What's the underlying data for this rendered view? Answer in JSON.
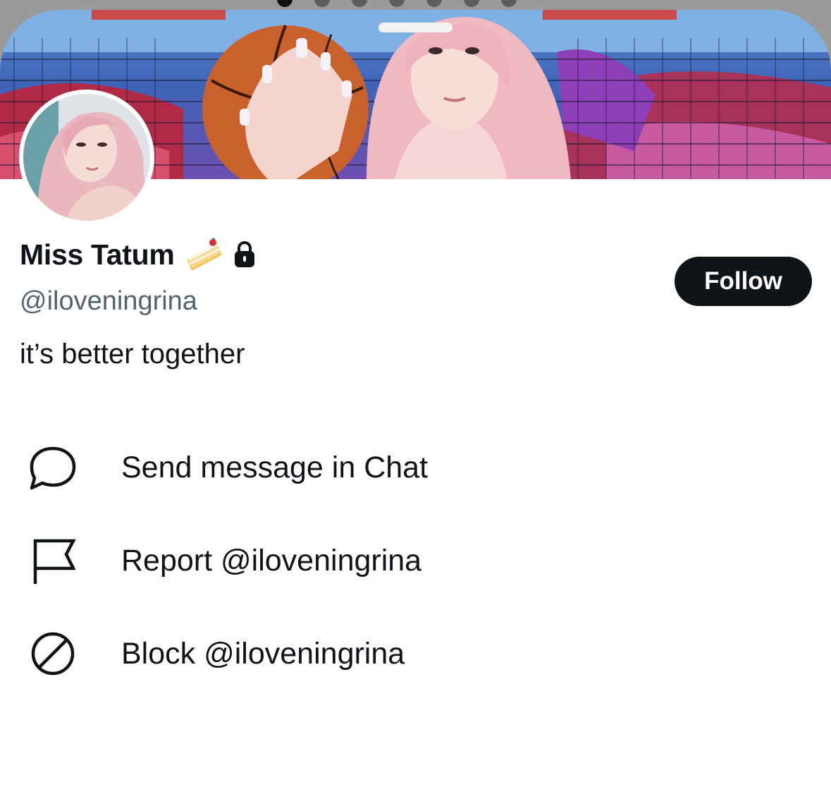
{
  "profile": {
    "display_name": "Miss Tatum",
    "handle": "@iloveningrina",
    "bio": "it’s better together",
    "name_icons": [
      "cake-icon",
      "lock-icon"
    ]
  },
  "actions": {
    "follow_label": "Follow"
  },
  "menu": {
    "items": [
      {
        "icon": "chat-bubble-icon",
        "label": "Send message in Chat"
      },
      {
        "icon": "flag-icon",
        "label": "Report @iloveningrina"
      },
      {
        "icon": "block-icon",
        "label": "Block @iloveningrina"
      }
    ]
  },
  "colors": {
    "text_primary": "#0f1419",
    "text_secondary": "#536471",
    "follow_button_bg": "#0f1419",
    "follow_button_text": "#ffffff",
    "sheet_bg": "#ffffff",
    "backdrop": "#9a9a9a"
  }
}
